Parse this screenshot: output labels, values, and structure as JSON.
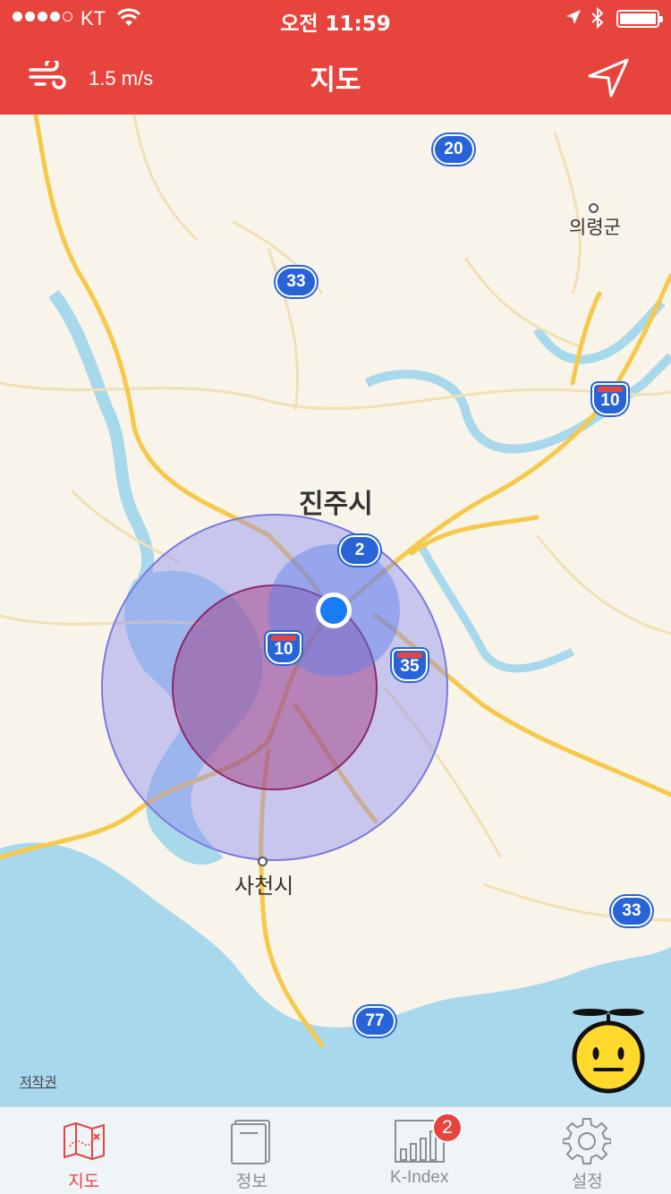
{
  "status_bar": {
    "carrier": "KT",
    "time": "오전 11:59",
    "signal_filled": 4,
    "battery_level": 1.0
  },
  "nav": {
    "title": "지도",
    "wind_speed": "1.5 m/s",
    "wind_icon": "wind-icon",
    "location_icon": "location-arrow-icon"
  },
  "map": {
    "places": {
      "jinju": "진주시",
      "sacheon": "사천시",
      "uiryeong": "의령군"
    },
    "route_shields": {
      "r20": "20",
      "r33_top": "33",
      "r10_right": "10",
      "r2": "2",
      "r10_center": "10",
      "r35": "35",
      "r33_bottom": "33",
      "r77": "77"
    },
    "copyright": "저작권",
    "colors": {
      "water": "#a8d8ec",
      "road_major": "#f6c94a",
      "land": "#f8f4ea",
      "zone_outer": "#8e8ef0",
      "zone_inner": "#a0307a",
      "user_location": "#1a7cf5"
    }
  },
  "tabbar": {
    "tabs": [
      {
        "label": "지도",
        "icon": "map-icon",
        "active": true
      },
      {
        "label": "정보",
        "icon": "info-book-icon",
        "active": false
      },
      {
        "label": "K-Index",
        "icon": "bar-chart-icon",
        "active": false,
        "badge": "2"
      },
      {
        "label": "설정",
        "icon": "gear-icon",
        "active": false
      }
    ]
  }
}
